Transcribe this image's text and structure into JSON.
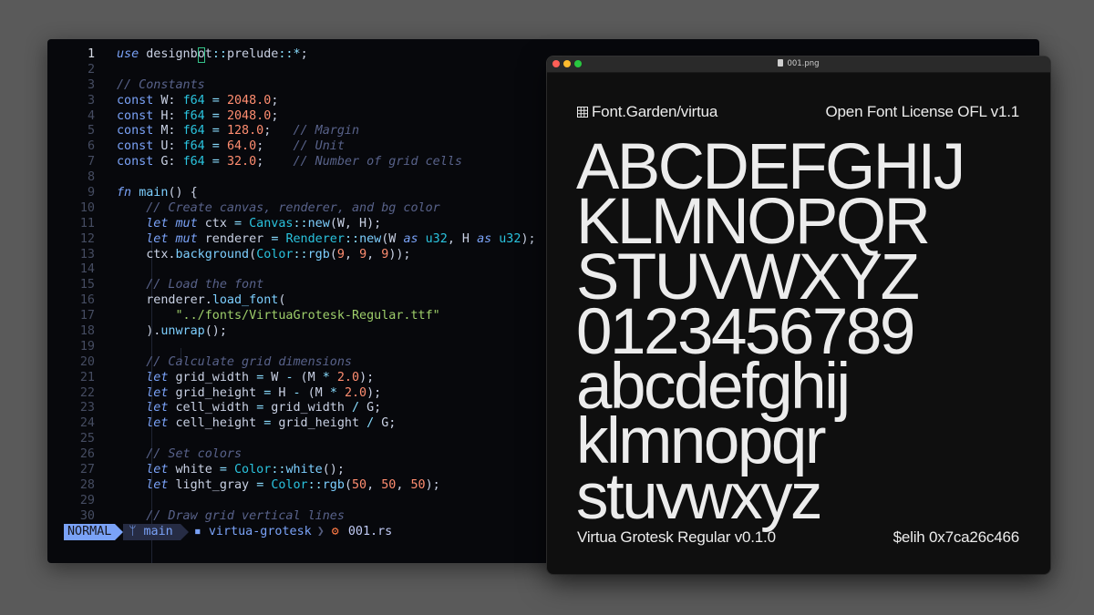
{
  "editor": {
    "lines": [
      {
        "n": "1",
        "current": true,
        "tokens": [
          [
            "kw",
            "use"
          ],
          [
            "pl",
            " designb"
          ],
          [
            "cursor",
            "o"
          ],
          [
            "pl",
            "t"
          ],
          [
            "op",
            "::"
          ],
          [
            "pl",
            "prelude"
          ],
          [
            "op",
            "::*"
          ],
          [
            "pl",
            ";"
          ]
        ]
      },
      {
        "n": "2",
        "tokens": []
      },
      {
        "n": "3",
        "tokens": [
          [
            "cm",
            "// Constants"
          ]
        ]
      },
      {
        "n": "3",
        "tokens": [
          [
            "kw2",
            "const"
          ],
          [
            "pl",
            " W: "
          ],
          [
            "ty",
            "f64"
          ],
          [
            "op",
            " = "
          ],
          [
            "num",
            "2048.0"
          ],
          [
            "pl",
            ";"
          ]
        ]
      },
      {
        "n": "4",
        "tokens": [
          [
            "kw2",
            "const"
          ],
          [
            "pl",
            " H: "
          ],
          [
            "ty",
            "f64"
          ],
          [
            "op",
            " = "
          ],
          [
            "num",
            "2048.0"
          ],
          [
            "pl",
            ";"
          ]
        ]
      },
      {
        "n": "5",
        "tokens": [
          [
            "kw2",
            "const"
          ],
          [
            "pl",
            " M: "
          ],
          [
            "ty",
            "f64"
          ],
          [
            "op",
            " = "
          ],
          [
            "num",
            "128.0"
          ],
          [
            "pl",
            ";   "
          ],
          [
            "cm",
            "// Margin"
          ]
        ]
      },
      {
        "n": "6",
        "tokens": [
          [
            "kw2",
            "const"
          ],
          [
            "pl",
            " U: "
          ],
          [
            "ty",
            "f64"
          ],
          [
            "op",
            " = "
          ],
          [
            "num",
            "64.0"
          ],
          [
            "pl",
            ";    "
          ],
          [
            "cm",
            "// Unit"
          ]
        ]
      },
      {
        "n": "7",
        "tokens": [
          [
            "kw2",
            "const"
          ],
          [
            "pl",
            " G: "
          ],
          [
            "ty",
            "f64"
          ],
          [
            "op",
            " = "
          ],
          [
            "num",
            "32.0"
          ],
          [
            "pl",
            ";    "
          ],
          [
            "cm",
            "// Number of grid cells"
          ]
        ]
      },
      {
        "n": "8",
        "tokens": []
      },
      {
        "n": "9",
        "tokens": [
          [
            "kw",
            "fn"
          ],
          [
            "pl",
            " "
          ],
          [
            "fn",
            "main"
          ],
          [
            "pl",
            "() {"
          ]
        ]
      },
      {
        "n": "10",
        "tokens": [
          [
            "pl",
            "    "
          ],
          [
            "cm",
            "// Create canvas, renderer, and bg color"
          ]
        ]
      },
      {
        "n": "11",
        "tokens": [
          [
            "pl",
            "    "
          ],
          [
            "kw",
            "let"
          ],
          [
            "pl",
            " "
          ],
          [
            "kw",
            "mut"
          ],
          [
            "pl",
            " ctx "
          ],
          [
            "op",
            "="
          ],
          [
            "pl",
            " "
          ],
          [
            "ty",
            "Canvas"
          ],
          [
            "op",
            "::"
          ],
          [
            "fn",
            "new"
          ],
          [
            "pl",
            "(W, H);"
          ]
        ]
      },
      {
        "n": "12",
        "tokens": [
          [
            "pl",
            "    "
          ],
          [
            "kw",
            "let"
          ],
          [
            "pl",
            " "
          ],
          [
            "kw",
            "mut"
          ],
          [
            "pl",
            " renderer "
          ],
          [
            "op",
            "="
          ],
          [
            "pl",
            " "
          ],
          [
            "ty",
            "Renderer"
          ],
          [
            "op",
            "::"
          ],
          [
            "fn",
            "new"
          ],
          [
            "pl",
            "(W "
          ],
          [
            "kw",
            "as"
          ],
          [
            "pl",
            " "
          ],
          [
            "ty",
            "u32"
          ],
          [
            "pl",
            ", H "
          ],
          [
            "kw",
            "as"
          ],
          [
            "pl",
            " "
          ],
          [
            "ty",
            "u32"
          ],
          [
            "pl",
            ");"
          ]
        ]
      },
      {
        "n": "13",
        "tokens": [
          [
            "pl",
            "    ctx."
          ],
          [
            "fn",
            "background"
          ],
          [
            "pl",
            "("
          ],
          [
            "ty",
            "Color"
          ],
          [
            "op",
            "::"
          ],
          [
            "fn",
            "rgb"
          ],
          [
            "pl",
            "("
          ],
          [
            "num",
            "9"
          ],
          [
            "pl",
            ", "
          ],
          [
            "num",
            "9"
          ],
          [
            "pl",
            ", "
          ],
          [
            "num",
            "9"
          ],
          [
            "pl",
            "));"
          ]
        ]
      },
      {
        "n": "14",
        "tokens": []
      },
      {
        "n": "15",
        "tokens": [
          [
            "pl",
            "    "
          ],
          [
            "cm",
            "// Load the font"
          ]
        ]
      },
      {
        "n": "16",
        "tokens": [
          [
            "pl",
            "    renderer."
          ],
          [
            "fn",
            "load_font"
          ],
          [
            "pl",
            "("
          ]
        ]
      },
      {
        "n": "17",
        "tokens": [
          [
            "pl",
            "        "
          ],
          [
            "st",
            "\"../fonts/VirtuaGrotesk-Regular.ttf\""
          ]
        ]
      },
      {
        "n": "18",
        "tokens": [
          [
            "pl",
            "    )."
          ],
          [
            "fn",
            "unwrap"
          ],
          [
            "pl",
            "();"
          ]
        ]
      },
      {
        "n": "19",
        "tokens": []
      },
      {
        "n": "20",
        "tokens": [
          [
            "pl",
            "    "
          ],
          [
            "cm",
            "// Calculate grid dimensions"
          ]
        ]
      },
      {
        "n": "21",
        "tokens": [
          [
            "pl",
            "    "
          ],
          [
            "kw",
            "let"
          ],
          [
            "pl",
            " grid_width "
          ],
          [
            "op",
            "="
          ],
          [
            "pl",
            " W "
          ],
          [
            "op",
            "-"
          ],
          [
            "pl",
            " (M "
          ],
          [
            "op",
            "*"
          ],
          [
            "pl",
            " "
          ],
          [
            "num",
            "2.0"
          ],
          [
            "pl",
            ");"
          ]
        ]
      },
      {
        "n": "22",
        "tokens": [
          [
            "pl",
            "    "
          ],
          [
            "kw",
            "let"
          ],
          [
            "pl",
            " grid_height "
          ],
          [
            "op",
            "="
          ],
          [
            "pl",
            " H "
          ],
          [
            "op",
            "-"
          ],
          [
            "pl",
            " (M "
          ],
          [
            "op",
            "*"
          ],
          [
            "pl",
            " "
          ],
          [
            "num",
            "2.0"
          ],
          [
            "pl",
            ");"
          ]
        ]
      },
      {
        "n": "23",
        "tokens": [
          [
            "pl",
            "    "
          ],
          [
            "kw",
            "let"
          ],
          [
            "pl",
            " cell_width "
          ],
          [
            "op",
            "="
          ],
          [
            "pl",
            " grid_width "
          ],
          [
            "op",
            "/"
          ],
          [
            "pl",
            " G;"
          ]
        ]
      },
      {
        "n": "24",
        "tokens": [
          [
            "pl",
            "    "
          ],
          [
            "kw",
            "let"
          ],
          [
            "pl",
            " cell_height "
          ],
          [
            "op",
            "="
          ],
          [
            "pl",
            " grid_height "
          ],
          [
            "op",
            "/"
          ],
          [
            "pl",
            " G;"
          ]
        ]
      },
      {
        "n": "25",
        "tokens": []
      },
      {
        "n": "26",
        "tokens": [
          [
            "pl",
            "    "
          ],
          [
            "cm",
            "// Set colors"
          ]
        ]
      },
      {
        "n": "27",
        "tokens": [
          [
            "pl",
            "    "
          ],
          [
            "kw",
            "let"
          ],
          [
            "pl",
            " white "
          ],
          [
            "op",
            "="
          ],
          [
            "pl",
            " "
          ],
          [
            "ty",
            "Color"
          ],
          [
            "op",
            "::"
          ],
          [
            "fn",
            "white"
          ],
          [
            "pl",
            "();"
          ]
        ]
      },
      {
        "n": "28",
        "tokens": [
          [
            "pl",
            "    "
          ],
          [
            "kw",
            "let"
          ],
          [
            "pl",
            " light_gray "
          ],
          [
            "op",
            "="
          ],
          [
            "pl",
            " "
          ],
          [
            "ty",
            "Color"
          ],
          [
            "op",
            "::"
          ],
          [
            "fn",
            "rgb"
          ],
          [
            "pl",
            "("
          ],
          [
            "num",
            "50"
          ],
          [
            "pl",
            ", "
          ],
          [
            "num",
            "50"
          ],
          [
            "pl",
            ", "
          ],
          [
            "num",
            "50"
          ],
          [
            "pl",
            ");"
          ]
        ]
      },
      {
        "n": "29",
        "tokens": []
      },
      {
        "n": "30",
        "tokens": [
          [
            "pl",
            "    "
          ],
          [
            "cm",
            "// Draw grid vertical lines"
          ]
        ]
      }
    ],
    "statusbar": {
      "mode": "NORMAL",
      "branch_icon": "git-branch-icon",
      "branch": "main",
      "folder_icon": "folder-icon",
      "folder": "virtua-grotesk",
      "file_icon": "rust-file-icon",
      "file": "001.rs"
    }
  },
  "preview": {
    "window_title": "001.png",
    "header_left": "Font.Garden/virtua",
    "header_right": "Open Font License OFL v1.1",
    "specimen": [
      "ABCDEFGHIJ",
      "KLMNOPQR",
      "STUVWXYZ",
      "0123456789",
      "abcdefghij",
      "klmnopqr",
      "stuvwxyz"
    ],
    "footer_left": "Virtua Grotesk Regular v0.1.0",
    "footer_right": "$elih 0x7ca26c466"
  }
}
